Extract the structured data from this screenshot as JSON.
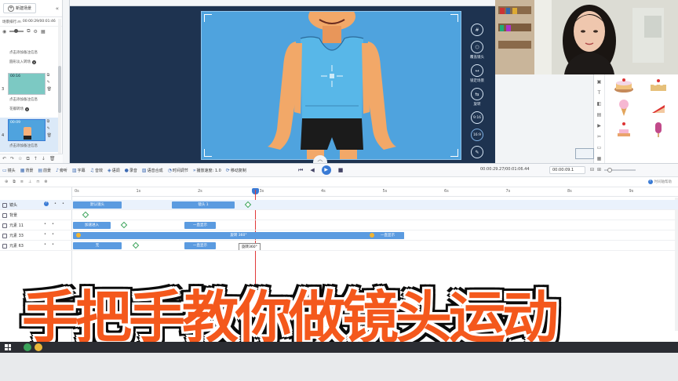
{
  "left_panel": {
    "new_scene_button": "新建场景",
    "timecode": "00:00:29/00:01:46",
    "scene_name": "场景排行.m",
    "scenes": [
      {
        "number": "",
        "label": "点击添加备注信息",
        "tag": "圆形淡入转场"
      },
      {
        "number": "3",
        "duration": "00:16",
        "label": "点击添加备注信息",
        "tag": "花瓣转场"
      },
      {
        "number": "4",
        "duration": "00:09",
        "label": "点击添加备注信息",
        "tag": ""
      }
    ]
  },
  "canvas": {
    "camera_tools": [
      {
        "icon": "#",
        "label": ""
      },
      {
        "icon": "⬡",
        "label": "覆盖镜头"
      },
      {
        "icon": "↔",
        "label": "锁定场景"
      },
      {
        "icon": "⇆",
        "label": "旋转"
      },
      {
        "icon": "9:16",
        "label": ""
      },
      {
        "icon": "16:9",
        "label": ""
      },
      {
        "icon": "✎",
        "label": ""
      }
    ]
  },
  "toolbar": {
    "tools": [
      {
        "icon": "▭",
        "label": "镜头"
      },
      {
        "icon": "▦",
        "label": "背景"
      },
      {
        "icon": "▤",
        "label": "前景"
      },
      {
        "icon": "♪",
        "label": "旁听"
      },
      {
        "icon": "▥",
        "label": "字幕"
      },
      {
        "icon": "♫",
        "label": "音效"
      },
      {
        "icon": "◈",
        "label": "语调"
      },
      {
        "icon": "●",
        "label": "录音"
      },
      {
        "icon": "▧",
        "label": "语音合成"
      },
      {
        "icon": "◔",
        "label": "时间调节"
      },
      {
        "icon": "»",
        "label": "播放速度: 1.0"
      },
      {
        "icon": "⟳",
        "label": "移动复制"
      }
    ],
    "current_time": "00:00:29.27/00:01:06.44",
    "time_input": "00:00:09.1"
  },
  "timeline": {
    "help_link": "时间轴帮助",
    "ruler_ticks": [
      "0s",
      "1s",
      "2s",
      "3s",
      "4s",
      "5s",
      "6s",
      "7s",
      "8s",
      "9s"
    ],
    "tracks": [
      {
        "name": "镜头",
        "clips": [
          {
            "label": "默认镜头"
          },
          {
            "label": "镜头 1"
          }
        ]
      },
      {
        "name": "背景",
        "clips": []
      },
      {
        "name": "元素 11",
        "clips": [
          {
            "label": "加速进入"
          },
          {
            "label": "一直显示"
          }
        ]
      },
      {
        "name": "元素 33",
        "clips": [
          {
            "label": "旋转 360°"
          },
          {
            "label": "一直显示"
          }
        ]
      },
      {
        "name": "元素 63",
        "clips": [
          {
            "label": "无"
          },
          {
            "label": "一直显示"
          }
        ]
      }
    ],
    "tooltip": "旋转360°"
  },
  "banner": {
    "title": "手把手教你做镜头运动",
    "text_color": "#f4581c"
  },
  "colors": {
    "canvas_bg": "#1e3350",
    "stage_bg": "#4fa3de",
    "clip_blue": "#5b9be0",
    "playhead": "#e23b3b"
  }
}
